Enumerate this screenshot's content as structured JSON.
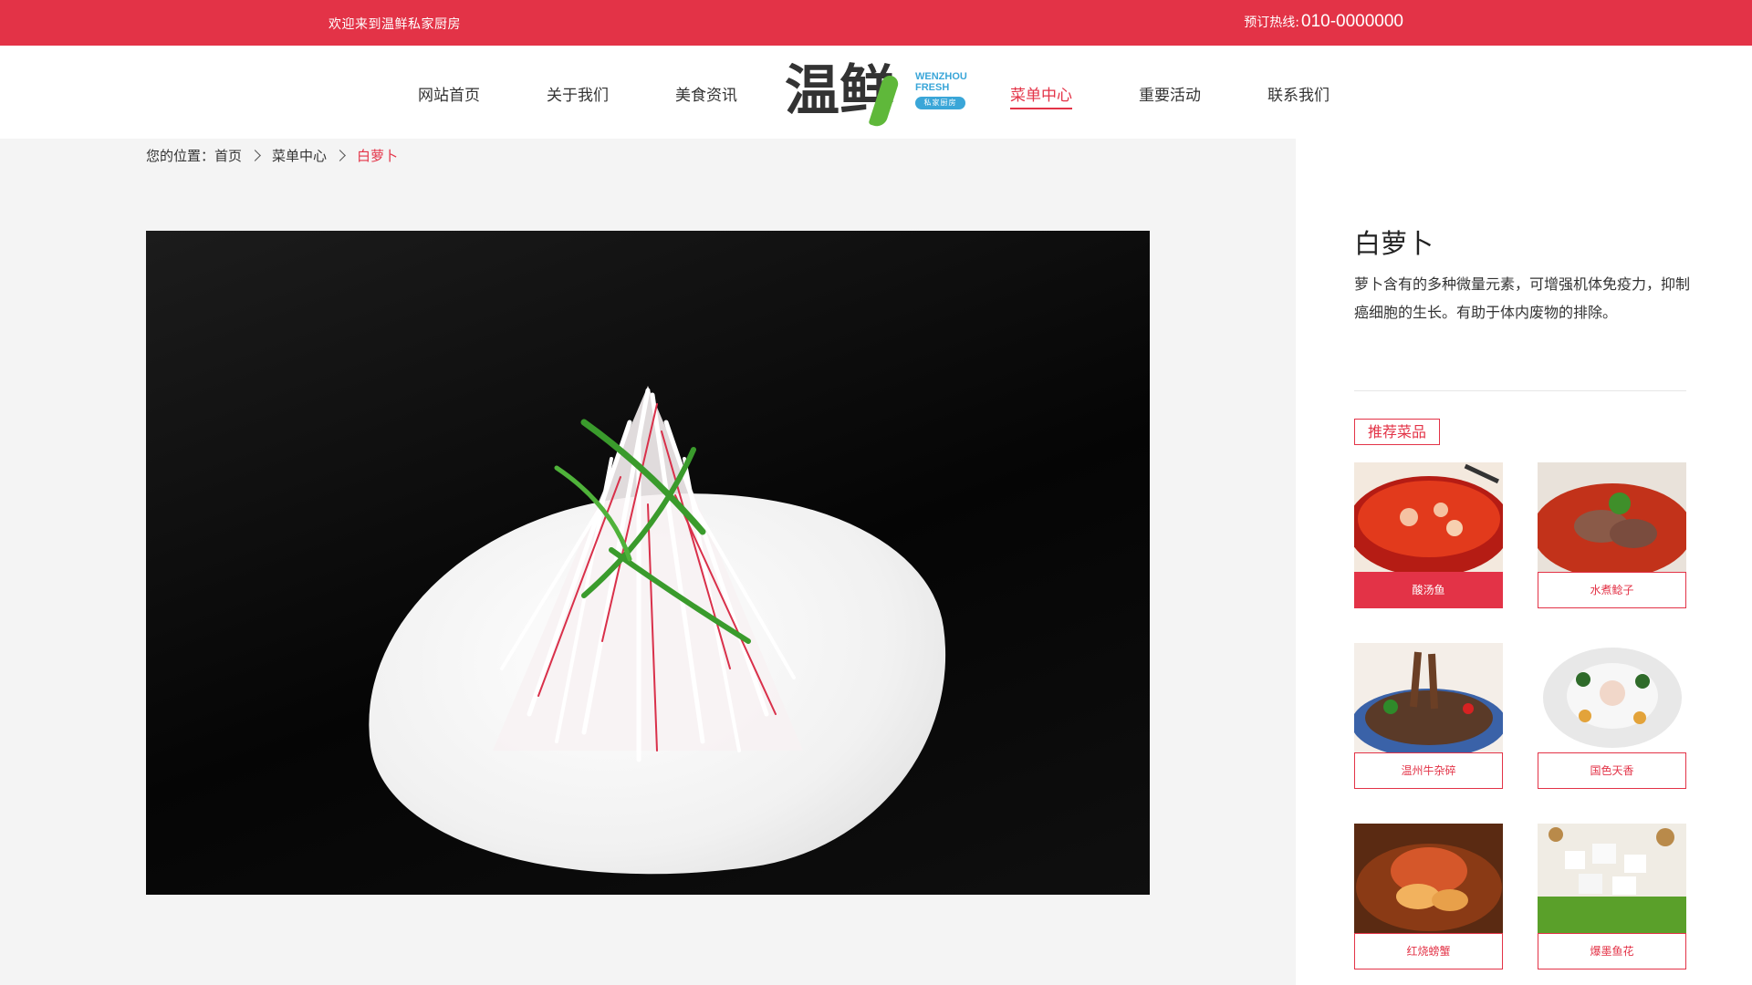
{
  "topbar": {
    "welcome": "欢迎来到温鲜私家厨房",
    "hotline_label": "预订热线:",
    "hotline_number": "010-0000000"
  },
  "nav": {
    "items": [
      {
        "label": "网站首页"
      },
      {
        "label": "关于我们"
      },
      {
        "label": "美食资讯"
      },
      {
        "label": "菜单中心",
        "active": true
      },
      {
        "label": "重要活动"
      },
      {
        "label": "联系我们"
      }
    ]
  },
  "logo": {
    "chinese": "温鲜",
    "english_line1": "WENZHOU",
    "english_line2": "FRESH",
    "badge": "私家厨房"
  },
  "breadcrumb": {
    "prefix": "您的位置：",
    "home": "首页",
    "section": "菜单中心",
    "current": "白萝卜"
  },
  "dish": {
    "title": "白萝卜",
    "description": "萝卜含有的多种微量元素，可增强机体免疫力，抑制癌细胞的生长。有助于体内废物的排除。"
  },
  "recommend": {
    "label": "推荐菜品",
    "items": [
      {
        "name": "酸汤鱼",
        "active": true
      },
      {
        "name": "水煮鲶子"
      },
      {
        "name": "温州牛杂碎"
      },
      {
        "name": "国色天香"
      },
      {
        "name": "红烧螃蟹"
      },
      {
        "name": "爆墨鱼花"
      }
    ]
  },
  "colors": {
    "accent": "#e33347",
    "background": "#f4f4f4"
  }
}
